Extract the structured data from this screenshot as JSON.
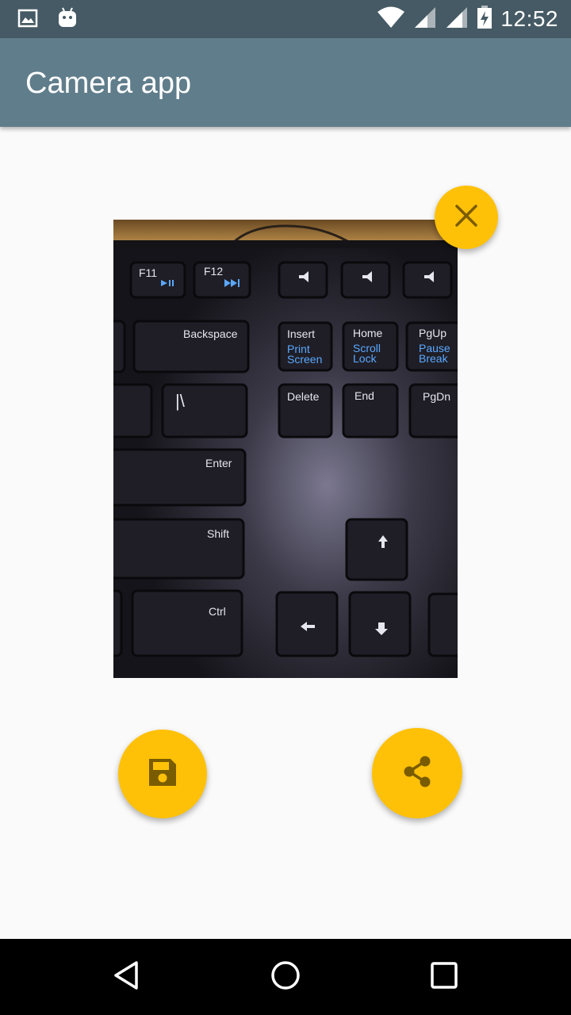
{
  "status_bar": {
    "time": "12:52",
    "icons": [
      "image-icon",
      "android-icon",
      "wifi-icon",
      "signal-icon",
      "signal-icon",
      "battery-charging-icon"
    ]
  },
  "app_bar": {
    "title": "Camera app"
  },
  "photo": {
    "subject": "keyboard-photo",
    "keys": {
      "f11": "F11",
      "f12": "F12",
      "backspace": "Backspace",
      "insert": "Insert",
      "print": "Print",
      "screen": "Screen",
      "home": "Home",
      "scroll": "Scroll",
      "lock": "Lock",
      "pgup": "PgUp",
      "pause": "Pause",
      "break": "Break",
      "delete": "Delete",
      "end": "End",
      "pgdn": "PgDn",
      "enter": "Enter",
      "shift": "Shift",
      "ctrl": "Ctrl",
      "backslash": "|\\"
    }
  },
  "actions": {
    "close_icon": "close-icon",
    "save_icon": "save-icon",
    "share_icon": "share-icon"
  },
  "colors": {
    "status_bar": "#455a64",
    "app_bar": "#607d8b",
    "accent": "#ffc107",
    "icon_dark": "#7a5c00",
    "background": "#fafafa"
  },
  "nav": {
    "buttons": [
      "back-icon",
      "home-icon",
      "recents-icon"
    ]
  }
}
